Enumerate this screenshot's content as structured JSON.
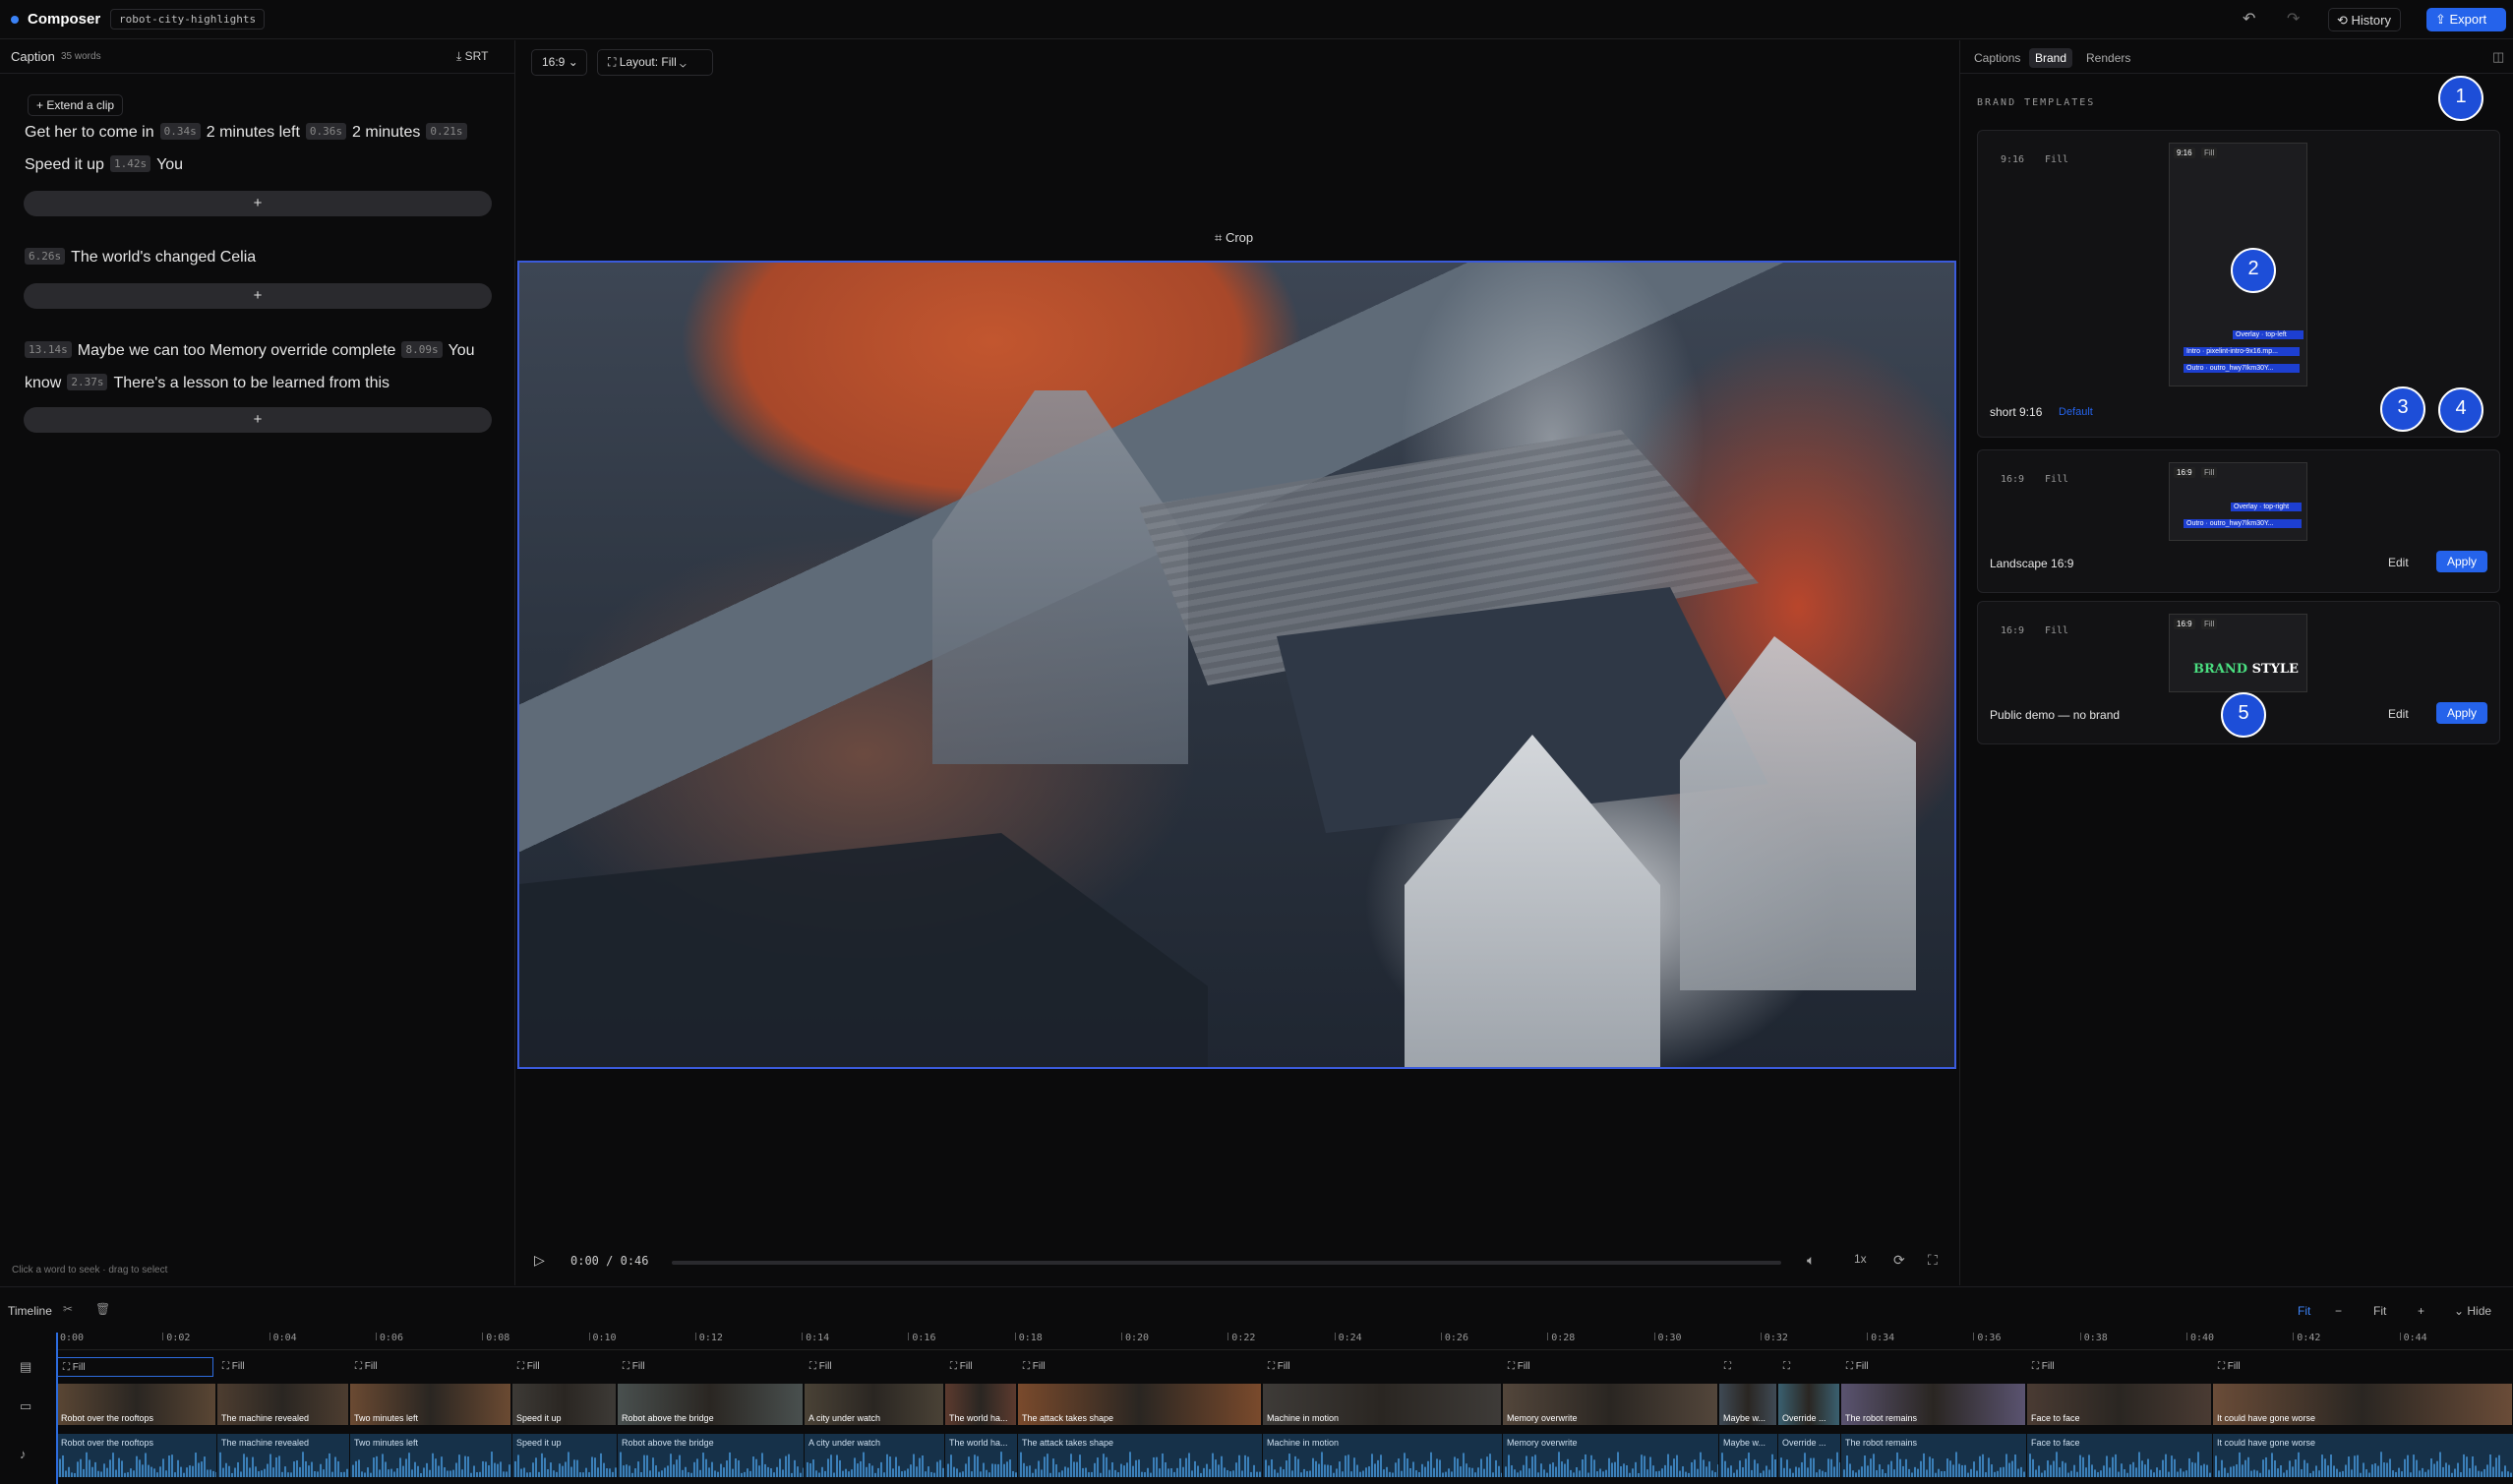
{
  "app": {
    "title": "Composer",
    "project": "robot-city-highlights"
  },
  "toolbar": {
    "undo_icon": "↶",
    "redo_icon": "↷",
    "history_label": "History",
    "export_label": "Export"
  },
  "caption_panel": {
    "title": "Caption",
    "word_count": "35 words",
    "srt_label": "SRT",
    "extend_label": "Extend a clip",
    "add_symbol": "+",
    "footer_hint": "Click a word to seek · drag to select",
    "blocks": [
      {
        "lines": [
          [
            {
              "t": "Get her to come in"
            },
            {
              "g": "0.34s"
            },
            {
              "t": "2 minutes left"
            },
            {
              "g": "0.36s"
            },
            {
              "t": "2 minutes"
            },
            {
              "g": "0.21s"
            }
          ],
          [
            {
              "t": "Speed it up"
            },
            {
              "g": "1.42s"
            },
            {
              "t": "You"
            }
          ]
        ]
      },
      {
        "lines": [
          [
            {
              "g": "6.26s"
            },
            {
              "t": "The world's changed Celia"
            }
          ]
        ]
      },
      {
        "lines": [
          [
            {
              "g": "13.14s"
            },
            {
              "t": "Maybe we can too Memory override complete"
            },
            {
              "g": "8.09s"
            },
            {
              "t": "You"
            }
          ],
          [
            {
              "t": "know"
            },
            {
              "g": "2.37s"
            },
            {
              "t": "There's a lesson to be learned from this"
            }
          ]
        ]
      }
    ]
  },
  "center": {
    "aspect_label": "16:9",
    "layout_label": "Layout: Fill",
    "crop_label": "Crop",
    "time_current": "0:00",
    "time_sep": "/",
    "time_total": "0:46",
    "speed": "1x"
  },
  "right_panel": {
    "tabs": [
      "Captions",
      "Brand",
      "Renders"
    ],
    "active_tab": "Brand",
    "section_title": "BRAND TEMPLATES",
    "templates": [
      {
        "aspect": "9:16",
        "fit": "Fill",
        "name": "short 9:16",
        "badge": "Default",
        "thumb_aspect": "9:16",
        "thumb_fit": "Fill",
        "overlays": [
          "Overlay · top-left",
          "Intro · pixelint-intro-9x16.mp...",
          "Outro · outro_hwy7Ikm30Y..."
        ]
      },
      {
        "aspect": "16:9",
        "fit": "Fill",
        "name": "Landscape 16:9",
        "thumb_aspect": "16:9",
        "thumb_fit": "Fill",
        "overlays": [
          "Overlay · top-right",
          "Outro · outro_hwy7Ikm30Y..."
        ],
        "edit": "Edit",
        "apply": "Apply"
      },
      {
        "aspect": "16:9",
        "fit": "Fill",
        "name": "Public demo — no brand",
        "thumb_aspect": "16:9",
        "thumb_fit": "Fill",
        "brand_word1": "BRAND",
        "brand_word2": "STYLE",
        "edit": "Edit",
        "apply": "Apply"
      }
    ],
    "markers": [
      "1",
      "2",
      "3",
      "4",
      "5"
    ]
  },
  "timeline": {
    "title": "Timeline",
    "fit_label": "Fit",
    "fit_label2": "Fit",
    "hide_label": "Hide",
    "ticks": [
      "0:00",
      "0:02",
      "0:04",
      "0:06",
      "0:08",
      "0:10",
      "0:12",
      "0:14",
      "0:16",
      "0:18",
      "0:20",
      "0:22",
      "0:24",
      "0:26",
      "0:28",
      "0:30",
      "0:32",
      "0:34",
      "0:36",
      "0:38",
      "0:40",
      "0:42",
      "0:44"
    ],
    "layout_label": "Fill",
    "clips": [
      "Robot over the rooftops",
      "The machine revealed",
      "Two minutes left",
      "Speed it up",
      "Robot above the bridge",
      "A city under watch",
      "The world ha...",
      "The attack takes shape",
      "Machine in motion",
      "Memory overwrite",
      "Maybe w...",
      "Override ...",
      "The robot remains",
      "Face to face",
      "It could have gone worse"
    ]
  },
  "colors": {
    "accent": "#2563eb",
    "background": "#0b0b0c",
    "selection": "#3b5bdb"
  }
}
